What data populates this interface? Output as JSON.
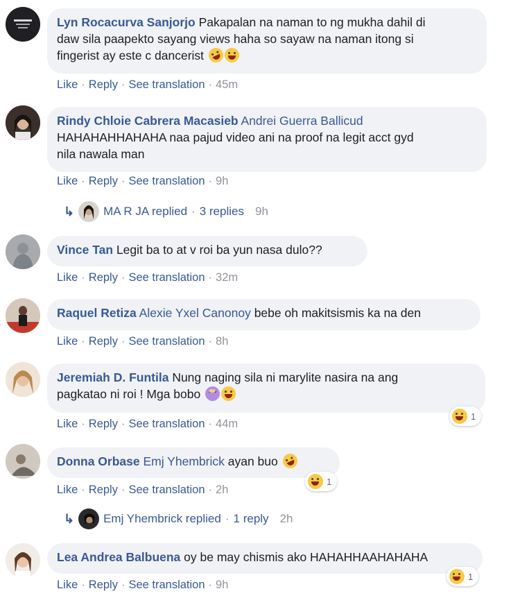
{
  "comments": [
    {
      "author": "Lyn Rocacurva Sanjorjo",
      "mention": "",
      "text_line1": "Pakapalan na naman to ng mukha dahil di",
      "text_line2": "daw sila paapekto sayang views haha so sayaw na naman itong si",
      "text_line3": "fingerist ay este c dancerist",
      "like": "Like",
      "reply": "Reply",
      "see_translation": "See translation",
      "time": "45m"
    },
    {
      "author": "Rindy Chloie Cabrera Macasieb",
      "mention": "Andrei Guerra Ballicud",
      "text_line2": "HAHAHAHHAHAHA naa pajud video ani na proof na legit acct gyd",
      "text_line3": "nila nawala man",
      "like": "Like",
      "reply": "Reply",
      "see_translation": "See translation",
      "time": "9h",
      "replies": {
        "name": "MA R JA replied",
        "count": "3 replies",
        "time": "9h"
      }
    },
    {
      "author": "Vince Tan",
      "text": "Legit ba to at v roi ba yun nasa dulo??",
      "like": "Like",
      "reply": "Reply",
      "see_translation": "See translation",
      "time": "32m"
    },
    {
      "author": "Raquel Retiza",
      "mention": "Alexie Yxel Canonoy",
      "text": "bebe oh makitsismis ka na den",
      "like": "Like",
      "reply": "Reply",
      "see_translation": "See translation",
      "time": "8h"
    },
    {
      "author": "Jeremiah D. Funtila",
      "text_line1": "Nung naging sila ni marylite nasira na ang",
      "text_line2": "pagkatao ni roi ! Mga bobo",
      "like": "Like",
      "reply": "Reply",
      "see_translation": "See translation",
      "time": "44m",
      "reaction_count": "1"
    },
    {
      "author": "Donna Orbase",
      "mention": "Emj Yhembrick",
      "text": "ayan buo",
      "like": "Like",
      "reply": "Reply",
      "see_translation": "See translation",
      "time": "2h",
      "reaction_count": "1",
      "replies": {
        "name": "Emj Yhembrick replied",
        "count": "1 reply",
        "time": "2h"
      }
    },
    {
      "author": "Lea Andrea Balbuena",
      "text": "oy be may chismis ako HAHAHHAAHAHAHA",
      "like": "Like",
      "reply": "Reply",
      "see_translation": "See translation",
      "time": "9h",
      "reaction_count": "1"
    }
  ],
  "separator": "·",
  "colors": {
    "link": "#385898",
    "meta": "#90949c",
    "bubble": "#f0f2f5",
    "emoji": "#f7c948"
  }
}
